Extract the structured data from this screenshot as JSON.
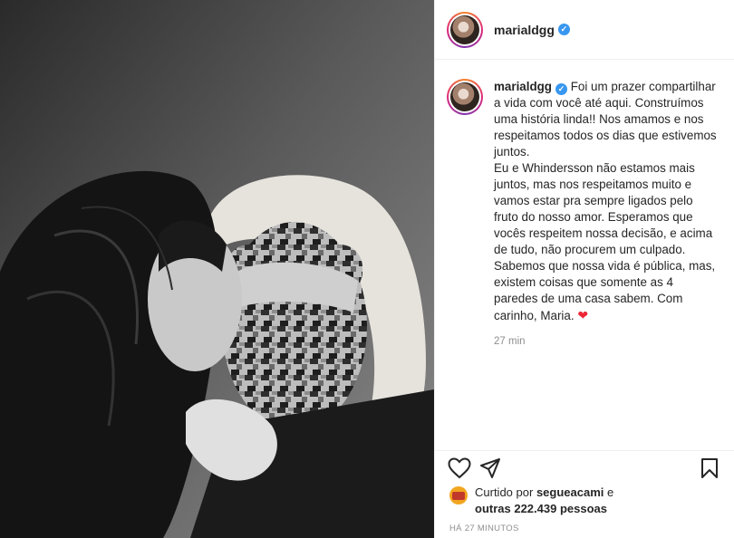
{
  "post": {
    "username": "marialdgg",
    "verified_icon": "verified-badge-icon",
    "caption": "Foi um prazer compartilhar a vida com você até aqui. Construímos uma história linda!! Nos amamos e nos respeitamos todos os dias que estivemos juntos.\nEu e Whindersson não estamos mais juntos, mas nos respeitamos muito e vamos estar pra sempre ligados pelo fruto do nosso amor. Esperamos que vocês respeitem nossa decisão, e acima de tudo, não procurem um culpado. Sabemos que nossa vida é pública, mas, existem coisas que somente as 4 paredes de uma casa sabem. Com carinho, Maria.",
    "caption_emoji": "❤",
    "caption_time": "27 min"
  },
  "actions": {
    "like_icon": "heart-outline-icon",
    "share_icon": "paper-plane-icon",
    "save_icon": "bookmark-icon"
  },
  "likes": {
    "prefix": "Curtido por",
    "liker": "segueacami",
    "connector": "e",
    "others": "outras 222.439 pessoas"
  },
  "timestamp": "HÁ 27 MINUTOS",
  "colors": {
    "verified": "#3897f0",
    "heart": "#ed2637",
    "meta_text": "#8e8e8e",
    "divider": "#efefef"
  }
}
